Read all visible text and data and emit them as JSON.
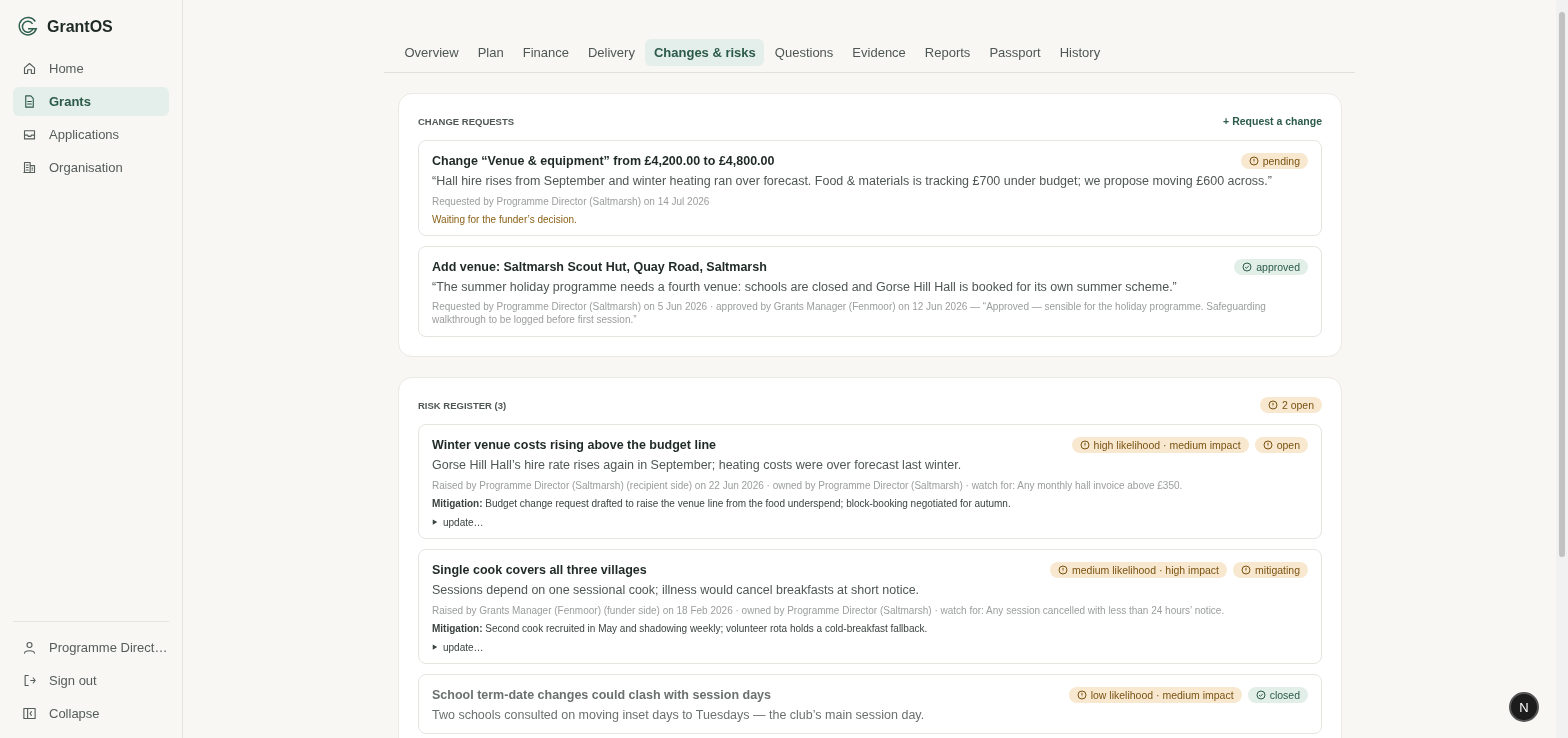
{
  "sidebar": {
    "brand": "GrantOS",
    "items": [
      {
        "label": "Home",
        "selected": false
      },
      {
        "label": "Grants",
        "selected": true
      },
      {
        "label": "Applications",
        "selected": false
      },
      {
        "label": "Organisation",
        "selected": false
      }
    ],
    "footer": [
      {
        "label": "Programme Direct…"
      },
      {
        "label": "Sign out"
      },
      {
        "label": "Collapse"
      }
    ]
  },
  "tabs": [
    {
      "label": "Overview",
      "selected": false
    },
    {
      "label": "Plan",
      "selected": false
    },
    {
      "label": "Finance",
      "selected": false
    },
    {
      "label": "Delivery",
      "selected": false
    },
    {
      "label": "Changes & risks",
      "selected": true
    },
    {
      "label": "Questions",
      "selected": false
    },
    {
      "label": "Evidence",
      "selected": false
    },
    {
      "label": "Reports",
      "selected": false
    },
    {
      "label": "Passport",
      "selected": false
    },
    {
      "label": "History",
      "selected": false
    }
  ],
  "change_requests": {
    "heading": "CHANGE REQUESTS",
    "action": "+ Request a change",
    "items": [
      {
        "title": "Change “Venue & equipment” from £4,200.00 to £4,800.00",
        "badge": {
          "label": "pending",
          "kind": "warning"
        },
        "quote": "“Hall hire rises from September and winter heating ran over forecast. Food & materials is tracking £700 under budget; we propose moving £600 across.”",
        "meta": "Requested by Programme Director (Saltmarsh) on 14 Jul 2026",
        "note": "Waiting for the funder’s decision."
      },
      {
        "title": "Add venue: Saltmarsh Scout Hut, Quay Road, Saltmarsh",
        "badge": {
          "label": "approved",
          "kind": "success"
        },
        "quote": "“The summer holiday programme needs a fourth venue: schools are closed and Gorse Hill Hall is booked for its own summer scheme.”",
        "meta": "Requested by Programme Director (Saltmarsh) on 5 Jun 2026 · approved by Grants Manager (Fenmoor) on 12 Jun 2026 — “Approved — sensible for the holiday programme. Safeguarding walkthrough to be logged before first session.”"
      }
    ]
  },
  "risk_register": {
    "heading": "RISK REGISTER (3)",
    "summary": {
      "label": "2 open",
      "kind": "warning"
    },
    "items": [
      {
        "title": "Winter venue costs rising above the budget line",
        "closed": false,
        "badges": [
          {
            "label": "high likelihood · medium impact",
            "kind": "warning"
          },
          {
            "label": "open",
            "kind": "warning"
          }
        ],
        "description": "Gorse Hill Hall’s hire rate rises again in September; heating costs were over forecast last winter.",
        "meta": "Raised by Programme Director (Saltmarsh) (recipient side) on 22 Jun 2026 · owned by Programme Director (Saltmarsh) · watch for: Any monthly hall invoice above £350.",
        "mitigation": "**Mitigation:** Budget change request drafted to raise the venue line from the food underspend; block-booking negotiated for autumn.",
        "toggle": "update…"
      },
      {
        "title": "Single cook covers all three villages",
        "closed": false,
        "badges": [
          {
            "label": "medium likelihood · high impact",
            "kind": "warning"
          },
          {
            "label": "mitigating",
            "kind": "warning"
          }
        ],
        "description": "Sessions depend on one sessional cook; illness would cancel breakfasts at short notice.",
        "meta": "Raised by Grants Manager (Fenmoor) (funder side) on 18 Feb 2026 · owned by Programme Director (Saltmarsh) · watch for: Any session cancelled with less than 24 hours’ notice.",
        "mitigation": "**Mitigation:** Second cook recruited in May and shadowing weekly; volunteer rota holds a cold-breakfast fallback.",
        "toggle": "update…"
      },
      {
        "title": "School term-date changes could clash with session days",
        "closed": true,
        "badges": [
          {
            "label": "low likelihood · medium impact",
            "kind": "warning"
          },
          {
            "label": "closed",
            "kind": "success"
          }
        ],
        "description": "Two schools consulted on moving inset days to Tuesdays — the club’s main session day."
      }
    ]
  },
  "assistant_button": {
    "label": "N"
  }
}
